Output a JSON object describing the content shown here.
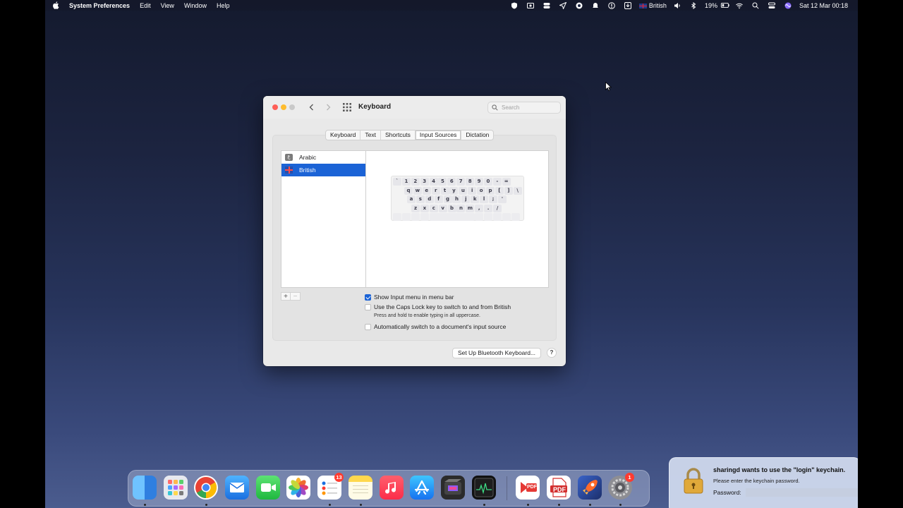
{
  "menubar": {
    "app_name": "System Preferences",
    "menus": [
      "Edit",
      "View",
      "Window",
      "Help"
    ],
    "input_source": "British",
    "battery": "19%",
    "datetime": "Sat 12 Mar  00:18"
  },
  "window": {
    "title": "Keyboard",
    "search_placeholder": "Search",
    "tabs": [
      "Keyboard",
      "Text",
      "Shortcuts",
      "Input Sources",
      "Dictation"
    ],
    "active_tab": "Input Sources",
    "sources": [
      "Arabic",
      "British"
    ],
    "selected_source": "British",
    "arabic_badge": "ع",
    "keyboard_rows": [
      [
        "`",
        "1",
        "2",
        "3",
        "4",
        "5",
        "6",
        "7",
        "8",
        "9",
        "0",
        "-",
        "="
      ],
      [
        "q",
        "w",
        "e",
        "r",
        "t",
        "y",
        "u",
        "i",
        "o",
        "p",
        "[",
        "]",
        "\\"
      ],
      [
        "a",
        "s",
        "d",
        "f",
        "g",
        "h",
        "j",
        "k",
        "l",
        ";",
        "'"
      ],
      [
        "z",
        "x",
        "c",
        "v",
        "b",
        "n",
        "m",
        ",",
        ".",
        "/"
      ]
    ],
    "add_label": "+",
    "remove_label": "−",
    "options": {
      "show_input_menu": "Show Input menu in menu bar",
      "caps_lock": "Use the Caps Lock key to switch to and from British",
      "caps_hint": "Press and hold to enable typing in all uppercase.",
      "auto_switch": "Automatically switch to a document's input source"
    },
    "bluetooth_button": "Set Up Bluetooth Keyboard...",
    "help_label": "?"
  },
  "dock": {
    "reminders_badge": "13",
    "prefs_badge": "1",
    "pdf_label": "PDF",
    "pdf2_label": "PDF"
  },
  "notification": {
    "title": "sharingd wants to use the \"login\" keychain.",
    "body": "Please enter the keychain password.",
    "password_label": "Password:"
  }
}
